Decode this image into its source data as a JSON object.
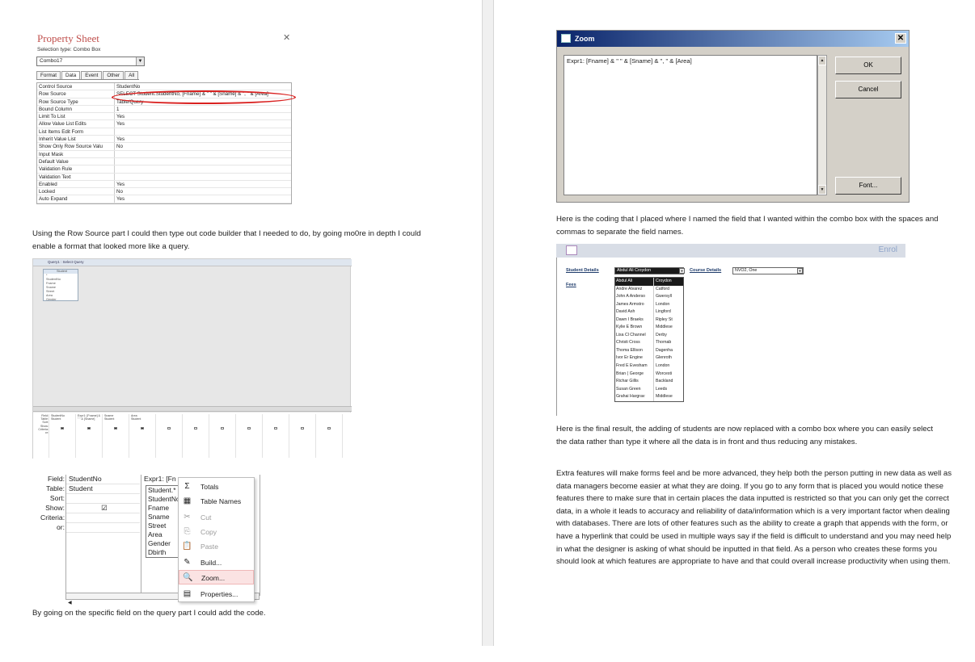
{
  "property_sheet": {
    "title": "Property Sheet",
    "selection_type": "Selection type:  Combo Box",
    "combo_value": "Combo17",
    "tabs": [
      "Format",
      "Data",
      "Event",
      "Other",
      "All"
    ],
    "rows": [
      {
        "k": "Control Source",
        "v": "StudentNo"
      },
      {
        "k": "Row Source",
        "v": "SELECT Student.StudentNo, [Fname] & \" \" & [Sname] & \", \" & [Area]"
      },
      {
        "k": "Row Source Type",
        "v": "Table/Query"
      },
      {
        "k": "Bound Column",
        "v": "1"
      },
      {
        "k": "Limit To List",
        "v": "Yes"
      },
      {
        "k": "Allow Value List Edits",
        "v": "Yes"
      },
      {
        "k": "List Items Edit Form",
        "v": ""
      },
      {
        "k": "Inherit Value List",
        "v": "Yes"
      },
      {
        "k": "Show Only Row Source Valu",
        "v": "No"
      },
      {
        "k": "Input Mask",
        "v": ""
      },
      {
        "k": "Default Value",
        "v": ""
      },
      {
        "k": "Validation Rule",
        "v": ""
      },
      {
        "k": "Validation Text",
        "v": ""
      },
      {
        "k": "Enabled",
        "v": "Yes"
      },
      {
        "k": "Locked",
        "v": "No"
      },
      {
        "k": "Auto Expand",
        "v": "Yes"
      }
    ]
  },
  "text": {
    "p1": "Using the Row Source part I could then type out code builder that I needed to do, by going mo0re in depth I could enable a format that looked more like a query.",
    "p2": "By going on the specific field on the query part I could add the code.",
    "p3": "Here is the coding that I placed where I named the field that I wanted within the combo box with the spaces and commas to separate the field names.",
    "p4": "Here is the final result, the adding of students are now replaced with a combo box where you can easily select the data rather than type it where all the data is in front and thus reducing any mistakes.",
    "p5": "Extra features will make forms feel and be more advanced, they help both the person putting in new data as well as data managers become easier at what they are doing. If you go to any form that is placed you would notice these features there to make sure that in certain places the data inputted is restricted so that you can only get the correct data, in a whole it leads to accuracy and reliability of data/information which is a very important factor when dealing with databases. There are lots of other features such as the ability to create a graph that appends with the form, or have a hyperlink that could be used in multiple ways say if the field is difficult to understand and you may need help in what the designer is asking of what should be inputted in that field. As a person who creates these forms you should look at which features are appropriate to have and that could overall increase productivity when using them."
  },
  "query_design": {
    "tab": "Query1 : Select Query",
    "table_name": "Student",
    "table_fields": [
      "*",
      "StudentNo",
      "Fname",
      "Sname",
      "Street",
      "Area",
      "Gender"
    ],
    "grid_labels": [
      "Field:",
      "Table:",
      "Sort:",
      "Show:",
      "Criteria:",
      "or:"
    ],
    "col1": {
      "field": "StudentNo",
      "table": "Student"
    },
    "col2": {
      "field": "Expr1: [Fname] & \" \" & [Sname]",
      "table": ""
    },
    "col3": {
      "field": "Sname",
      "table": "Student"
    },
    "col4": {
      "field": "Area",
      "table": "Student"
    }
  },
  "query_field": {
    "labels": [
      "Field:",
      "Table:",
      "Sort:",
      "Show:",
      "Criteria:",
      "or:"
    ],
    "field": "StudentNo",
    "table": "Student",
    "expr": "Expr1: [Fn",
    "dropdown": [
      "Student.*",
      "StudentNo",
      "Fname",
      "Sname",
      "Street",
      "Area",
      "Gender",
      "Dbirth"
    ],
    "show_check": "☑"
  },
  "context_menu": [
    {
      "label": "Totals",
      "icon": "Σ",
      "name": "totals"
    },
    {
      "label": "Table Names",
      "icon": "▦",
      "name": "table-names"
    },
    {
      "label": "Cut",
      "icon": "✂",
      "name": "cut"
    },
    {
      "label": "Copy",
      "icon": "⎘",
      "name": "copy"
    },
    {
      "label": "Paste",
      "icon": "📋",
      "name": "paste"
    },
    {
      "label": "Build...",
      "icon": "✎",
      "name": "build"
    },
    {
      "label": "Zoom...",
      "icon": "🔍",
      "name": "zoom"
    },
    {
      "label": "Properties...",
      "icon": "▤",
      "name": "properties"
    }
  ],
  "zoom": {
    "title": "Zoom",
    "expression": "Expr1: [Fname] & \" \" & [Sname] & \", \" & [Area]",
    "ok": "OK",
    "cancel": "Cancel",
    "font": "Font..."
  },
  "enrol": {
    "title": "Enrol",
    "student_label": "Student Details",
    "course_label": "Course Details",
    "fees_label": "Fees",
    "student_value": "Abdul Ali  Croydon",
    "course_value": "NVO2, One",
    "list": [
      [
        "Abdul  Ali",
        "Croydon"
      ],
      [
        "Andre Alvarez",
        "Catford"
      ],
      [
        "John A Anderso",
        "Gwersyll"
      ],
      [
        "James  Armstro",
        "London"
      ],
      [
        "David  Ash",
        "Lingford"
      ],
      [
        "Dawn I Braeks",
        "Ripley St"
      ],
      [
        "Kylie E Brown",
        "Middlese"
      ],
      [
        "Lisa Cl Channel",
        "Derby"
      ],
      [
        "Christi Cross",
        "Thornab"
      ],
      [
        "Thoma Ellison",
        "Dagenha"
      ],
      [
        "Ivor Er Engine",
        "Glenroth"
      ],
      [
        "Fred E Evesham",
        "London"
      ],
      [
        "Brian ( George",
        "Worcesti"
      ],
      [
        "Richar Gillis",
        "Backland"
      ],
      [
        "Susan  Green",
        "Leeds"
      ],
      [
        "Grahai Hargrav",
        "Middlese"
      ]
    ]
  }
}
